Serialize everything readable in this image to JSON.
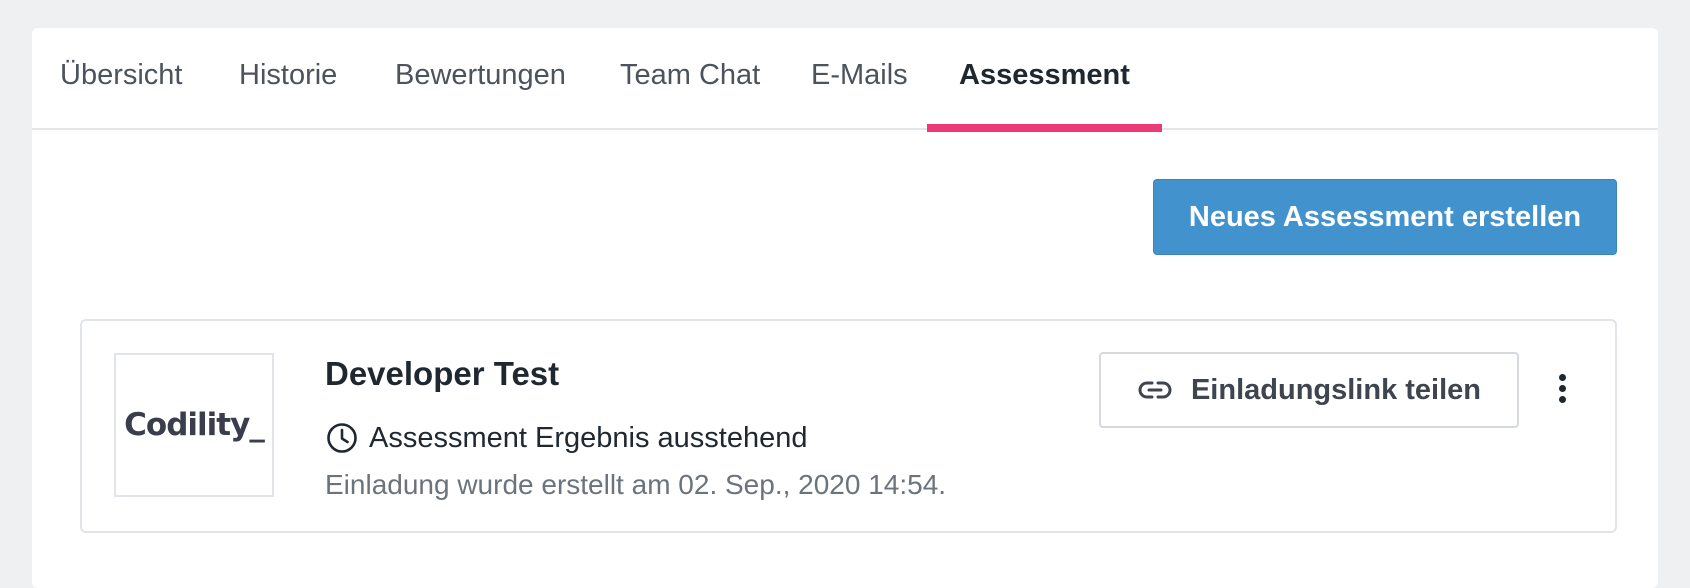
{
  "tabs": [
    {
      "label": "Übersicht",
      "active": false
    },
    {
      "label": "Historie",
      "active": false
    },
    {
      "label": "Bewertungen",
      "active": false
    },
    {
      "label": "Team Chat",
      "active": false
    },
    {
      "label": "E-Mails",
      "active": false
    },
    {
      "label": "Assessment",
      "active": true
    }
  ],
  "actions": {
    "create_assessment_label": "Neues Assessment erstellen"
  },
  "assessment": {
    "logo_text": "Codility_",
    "title": "Developer Test",
    "status_icon": "clock-icon",
    "status": "Assessment Ergebnis ausstehend",
    "created_info": "Einladung wurde erstellt am 02. Sep., 2020 14:54.",
    "share_icon": "link-icon",
    "share_label": "Einladungslink teilen",
    "more_icon": "kebab-menu-icon"
  },
  "colors": {
    "accent_underline": "#ec3a74",
    "primary_button": "#4293cd",
    "background": "#eff0f2"
  }
}
